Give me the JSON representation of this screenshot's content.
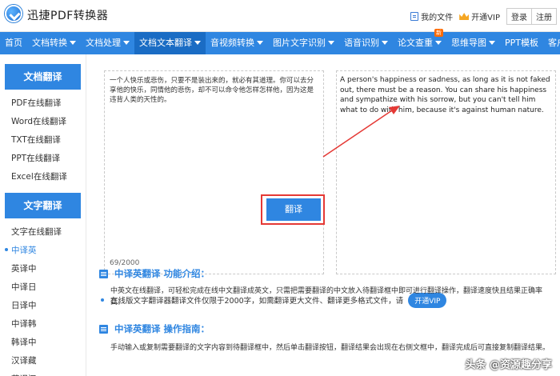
{
  "header": {
    "brand": "迅捷PDF转换器",
    "my_files": "我的文件",
    "vip": "开通VIP",
    "login": "登录",
    "register": "注册"
  },
  "nav": {
    "items": [
      {
        "label": "首页",
        "caret": false
      },
      {
        "label": "文档转换",
        "caret": true
      },
      {
        "label": "文档处理",
        "caret": true
      },
      {
        "label": "文档文本翻译",
        "caret": true,
        "active": true
      },
      {
        "label": "音视频转换",
        "caret": true
      },
      {
        "label": "图片文字识别",
        "caret": true
      },
      {
        "label": "语音识别",
        "caret": true
      },
      {
        "label": "论文查重",
        "caret": true,
        "badge": "新"
      },
      {
        "label": "思维导图",
        "caret": true
      },
      {
        "label": "PPT模板",
        "caret": false
      },
      {
        "label": "客户端",
        "caret": true
      }
    ]
  },
  "sidebar": {
    "doc_head": "文档翻译",
    "doc_items": [
      "PDF在线翻译",
      "Word在线翻译",
      "TXT在线翻译",
      "PPT在线翻译",
      "Excel在线翻译"
    ],
    "text_head": "文字翻译",
    "text_items": [
      "文字在线翻译",
      "中译英",
      "英译中",
      "中译日",
      "日译中",
      "中译韩",
      "韩译中",
      "汉译藏",
      "藏译汉"
    ]
  },
  "translator": {
    "source_text": "一个人快乐或悲伤，只要不是装出来的，就必有其道理。你可以去分享他的快乐，同情他的悲伤，却不可以命令他怎样怎样他，因为这是违背人类的天性的。",
    "counter": "69/2000",
    "translate_label": "翻译",
    "result_text": "A person's happiness or sadness, as long as it is not faked out, there must be a reason. You can share his happiness and sympathize with his sorrow, but you can't tell him what to do with him, because it's against human nature."
  },
  "notice": {
    "text": "在线版文字翻译器翻译文件仅限于2000字，如需翻译更大文件、翻译更多格式文件，请",
    "vip_button": "开通VIP"
  },
  "intro": {
    "title": "中译英翻译 功能介绍：",
    "body": "中英文在线翻译，可轻松完成在线中文翻译成英文，只需把需要翻译的中文放入待翻译框中即可进行翻译操作，翻译速度快且结果正确率高。"
  },
  "guide": {
    "title": "中译英翻译 操作指南：",
    "body": "手动输入或复制需要翻译的文字内容到待翻译框中，然后单击翻译按钮，翻译结果会出现在右侧文框中，翻译完成后可直接复制翻译结果。"
  },
  "watermark": "头条 @资源趣分享"
}
